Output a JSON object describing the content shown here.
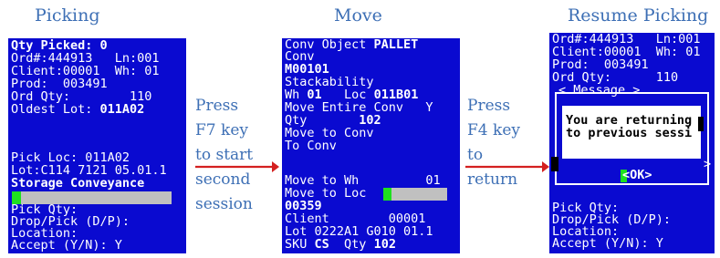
{
  "captions": {
    "picking": "Picking",
    "move": "Move",
    "resume": "Resume Picking"
  },
  "picking_screen": {
    "qty_picked": "Qty Picked: 0",
    "ord_ln": "Ord#:444913   Ln:001",
    "client_wh": "Client:00001  Wh: 01",
    "prod": "Prod:  003491",
    "ord_qty": "Ord Qty:        110",
    "oldest_lot_label": "Oldest Lot: ",
    "oldest_lot_value": "011A02",
    "pick_loc": "Pick Loc: 011A02",
    "lot": "Lot:C114 7121 05.01.1",
    "storage": "Storage Conveyance",
    "pick_qty": "Pick Qty:",
    "drop_pick": "Drop/Pick (D/P):",
    "location": "Location:",
    "accept": "Accept (Y/N): Y"
  },
  "instruction1": {
    "line1": "Press",
    "line2": "F7 key",
    "line3": "to start",
    "line4": "second",
    "line5": "session"
  },
  "move_screen": {
    "conv_object_label": "Conv Object ",
    "conv_object_value": "PALLET",
    "conv": "Conv",
    "conv_id": "M00101",
    "stackability": "Stackability",
    "wh_label": "Wh ",
    "wh_value": "01",
    "loc_label": "   Loc ",
    "loc_value": "011B01",
    "move_entire": "Move Entire Conv   Y",
    "qty_label": "Qty       ",
    "qty_value": "102",
    "move_to_conv": "Move to Conv",
    "to_conv": "To Conv",
    "move_to_wh": "Move to Wh         01",
    "move_to_loc": "Move to Loc",
    "loc_entry": "00359",
    "client": "Client        00001",
    "lot": "Lot 0222A1 G010 01.1",
    "sku_label": "SKU ",
    "sku_value": "CS",
    "sku_qty_label": "  Qty ",
    "sku_qty_value": "102"
  },
  "instruction2": {
    "line1": "Press",
    "line2": "F4 key",
    "line3": "to",
    "line4": "return"
  },
  "resume_screen": {
    "ord_ln": "Ord#:444913   Ln:001",
    "client_wh": "Client:00001  Wh: 01",
    "prod": "Prod:  003491",
    "ord_qty": "Ord Qty:      110",
    "message_title": "< Message >",
    "msg_line1": "You are returning",
    "msg_line2": "to previous sessi",
    "right_arrow": ">",
    "ok_button": "<OK>",
    "pick_qty": "Pick Qty:",
    "drop_pick": "Drop/Pick (D/P):",
    "location": "Location:",
    "accept": "Accept (Y/N): Y"
  },
  "colors": {
    "screen_bg": "#0a0ad0",
    "caption": "#3d6fb5",
    "arrow": "#d42020",
    "cursor": "#1fe01f"
  }
}
